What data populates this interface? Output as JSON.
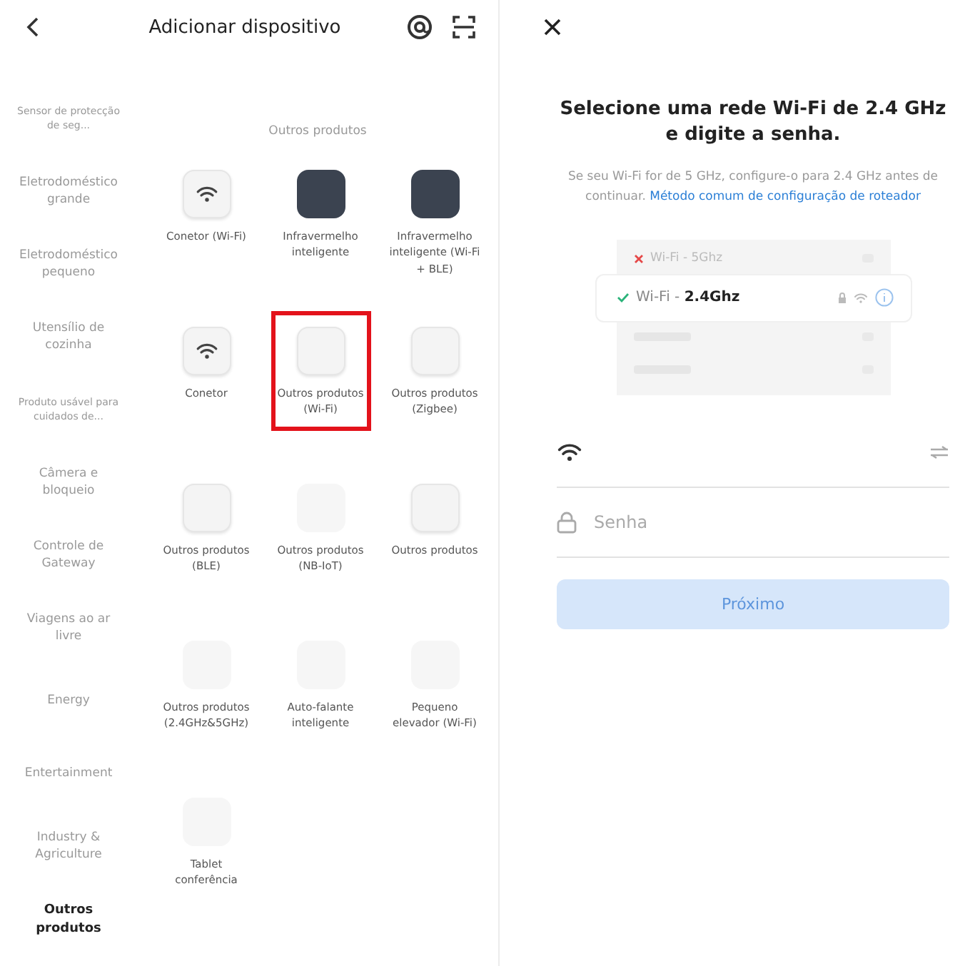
{
  "header": {
    "title": "Adicionar dispositivo"
  },
  "sidebar": {
    "items": [
      {
        "label": "Sensor de protecção de seg...",
        "kind": "compact",
        "selected": false
      },
      {
        "label": "Eletrodoméstico grande",
        "kind": "normal",
        "selected": false
      },
      {
        "label": "Eletrodoméstico pequeno",
        "kind": "normal",
        "selected": false
      },
      {
        "label": "Utensílio de cozinha",
        "kind": "normal",
        "selected": false
      },
      {
        "label": "Produto usável para cuidados de...",
        "kind": "compact",
        "selected": false
      },
      {
        "label": "Câmera e bloqueio",
        "kind": "normal",
        "selected": false
      },
      {
        "label": "Controle de Gateway",
        "kind": "normal",
        "selected": false
      },
      {
        "label": "Viagens ao ar livre",
        "kind": "normal",
        "selected": false
      },
      {
        "label": "Energy",
        "kind": "normal",
        "selected": false
      },
      {
        "label": "Entertainment",
        "kind": "normal",
        "selected": false
      },
      {
        "label": "Industry & Agriculture",
        "kind": "normal",
        "selected": false
      },
      {
        "label": "Outros produtos",
        "kind": "normal",
        "selected": true
      }
    ]
  },
  "section": {
    "title": "Outros produtos"
  },
  "devices": [
    {
      "label": "Conetor (Wi-Fi)",
      "kind": "wifi",
      "highlighted": false
    },
    {
      "label": "Infravermelho inteligente",
      "kind": "dark",
      "highlighted": false
    },
    {
      "label": "Infravermelho inteligente (Wi-Fi + BLE)",
      "kind": "dark",
      "highlighted": false
    },
    {
      "label": "Conetor",
      "kind": "wifi",
      "highlighted": false
    },
    {
      "label": "Outros produtos (Wi-Fi)",
      "kind": "plain",
      "highlighted": true
    },
    {
      "label": "Outros produtos (Zigbee)",
      "kind": "plain",
      "highlighted": false
    },
    {
      "label": "Outros produtos (BLE)",
      "kind": "plain",
      "highlighted": false
    },
    {
      "label": "Outros produtos (NB-IoT)",
      "kind": "faint",
      "highlighted": false
    },
    {
      "label": "Outros produtos",
      "kind": "plain",
      "highlighted": false
    },
    {
      "label": "Outros produtos (2.4GHz&5GHz)",
      "kind": "faint",
      "highlighted": false
    },
    {
      "label": "Auto-falante inteligente",
      "kind": "faint",
      "highlighted": false
    },
    {
      "label": "Pequeno elevador (Wi-Fi)",
      "kind": "faint",
      "highlighted": false
    },
    {
      "label": "Tablet conferência",
      "kind": "faint",
      "highlighted": false
    }
  ],
  "wifi_setup": {
    "title": "Selecione uma rede Wi-Fi de 2.4 GHz e digite a senha.",
    "note": "Se seu Wi-Fi for de 5 GHz, configure-o para 2.4 GHz antes de continuar.",
    "link": "Método comum de configuração de roteador",
    "networks": [
      {
        "label": "Wi-Fi - 5Ghz",
        "kind": "rejected"
      },
      {
        "label": "Wi-Fi - **2.4Ghz**",
        "kind": "accepted"
      },
      {
        "kind": "blank"
      },
      {
        "kind": "blank"
      }
    ],
    "fields": [
      {
        "kind": "network"
      },
      {
        "kind": "password",
        "placeholder": "Senha"
      }
    ],
    "button": {
      "label": "Próximo",
      "disabled": true
    }
  }
}
